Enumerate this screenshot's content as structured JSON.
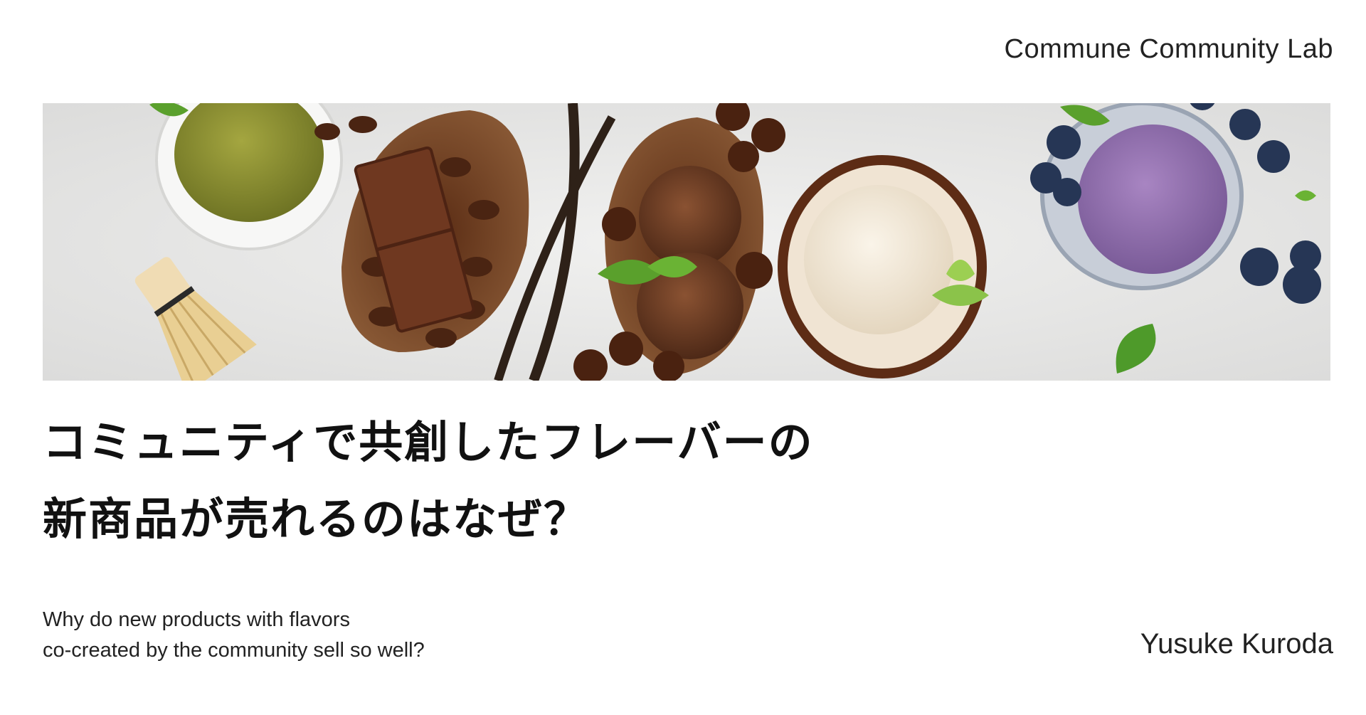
{
  "header": {
    "organization": "Commune Community Lab"
  },
  "hero_image": {
    "icon": "ice-cream-photo",
    "flavors": [
      "matcha",
      "chocolate",
      "vanilla",
      "blueberry"
    ]
  },
  "title": {
    "line1": "コミュニティで共創したフレーバーの",
    "line2": "新商品が売れるのはなぜ？"
  },
  "subtitle": {
    "line1": "Why do new products with flavors",
    "line2": "co-created by the community sell so well?"
  },
  "author": {
    "name": "Yusuke Kuroda"
  },
  "colors": {
    "background": "#ffffff",
    "text": "#111111",
    "matcha": "#8a8d2c",
    "chocolate": "#6b3a22",
    "vanilla": "#f2e8d8",
    "blueberry": "#8c6aa8"
  }
}
